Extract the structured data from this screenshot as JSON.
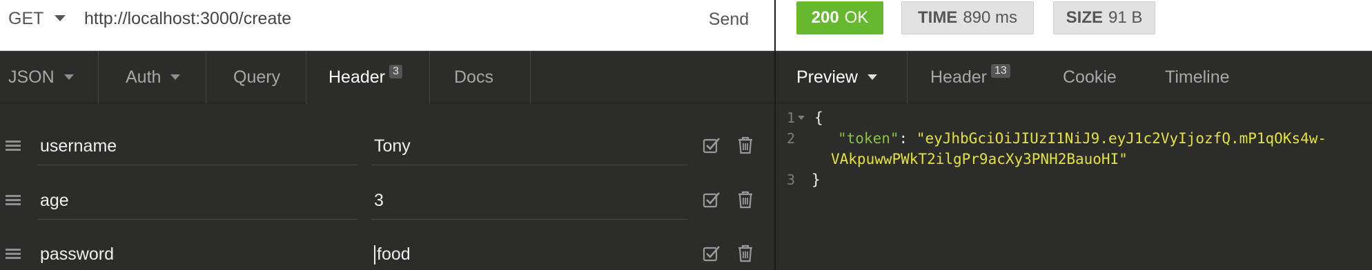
{
  "request": {
    "method": "GET",
    "url": "http://localhost:3000/create",
    "send_label": "Send",
    "tabs": [
      {
        "label": "JSON",
        "dropdown": true
      },
      {
        "label": "Auth",
        "dropdown": true
      },
      {
        "label": "Query"
      },
      {
        "label": "Header",
        "badge": "3",
        "active": true
      },
      {
        "label": "Docs"
      }
    ],
    "headers": [
      {
        "name": "username",
        "value": "Tony",
        "enabled": true
      },
      {
        "name": "age",
        "value": "3",
        "enabled": true
      },
      {
        "name": "password",
        "value": "food",
        "enabled": true
      }
    ]
  },
  "response": {
    "status_code": "200",
    "status_text": "OK",
    "time_label": "TIME",
    "time_value": "890 ms",
    "size_label": "SIZE",
    "size_value": "91 B",
    "tabs": [
      {
        "label": "Preview",
        "dropdown": true,
        "active": true
      },
      {
        "label": "Header",
        "badge": "13"
      },
      {
        "label": "Cookie"
      },
      {
        "label": "Timeline"
      }
    ],
    "body": {
      "line_numbers": [
        "1",
        "2",
        "3"
      ],
      "open_brace": "{",
      "key": "\"token\"",
      "colon": ": ",
      "token_part1": "\"eyJhbGciOiJIUzI1NiJ9.eyJ1c2VyIjozfQ.mP1qOKs4w-",
      "token_part2": "VAkpuwwPWkT2ilgPr9acXy3PNH2BauoHI\"",
      "close_brace": "}"
    }
  },
  "colors": {
    "status_ok": "#66b82e",
    "json_key": "#88c43d",
    "json_string": "#e5e33b",
    "panel_bg": "#2c2c2a"
  }
}
